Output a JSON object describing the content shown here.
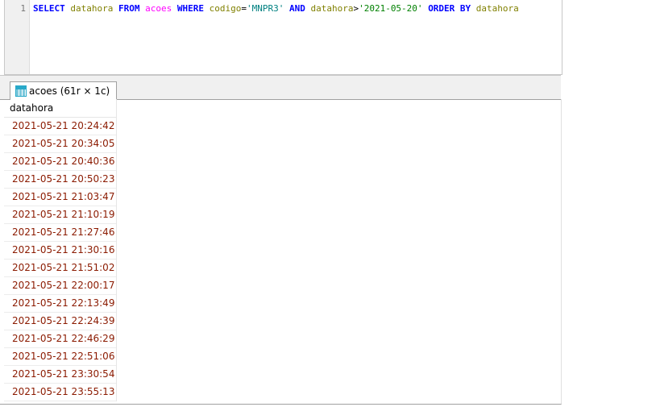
{
  "editor": {
    "line_number": "1",
    "tokens": [
      {
        "t": "SELECT",
        "c": "kw"
      },
      {
        "t": " ",
        "c": "op"
      },
      {
        "t": "datahora",
        "c": "id"
      },
      {
        "t": " ",
        "c": "op"
      },
      {
        "t": "FROM",
        "c": "kw"
      },
      {
        "t": " ",
        "c": "op"
      },
      {
        "t": "acoes",
        "c": "tb"
      },
      {
        "t": " ",
        "c": "op"
      },
      {
        "t": "WHERE",
        "c": "kw"
      },
      {
        "t": " ",
        "c": "op"
      },
      {
        "t": "codigo",
        "c": "id"
      },
      {
        "t": "=",
        "c": "op"
      },
      {
        "t": "'MNPR3'",
        "c": "st"
      },
      {
        "t": " ",
        "c": "op"
      },
      {
        "t": "AND",
        "c": "kw"
      },
      {
        "t": " ",
        "c": "op"
      },
      {
        "t": "datahora",
        "c": "id"
      },
      {
        "t": ">",
        "c": "op"
      },
      {
        "t": "'2021-05-20'",
        "c": "st2"
      },
      {
        "t": " ",
        "c": "op"
      },
      {
        "t": "ORDER BY",
        "c": "kw"
      },
      {
        "t": " ",
        "c": "op"
      },
      {
        "t": "datahora",
        "c": "id"
      }
    ]
  },
  "results": {
    "tab_label": "acoes (61r × 1c)",
    "column": "datahora",
    "rows": [
      "2021-05-21 20:24:42",
      "2021-05-21 20:34:05",
      "2021-05-21 20:40:36",
      "2021-05-21 20:50:23",
      "2021-05-21 21:03:47",
      "2021-05-21 21:10:19",
      "2021-05-21 21:27:46",
      "2021-05-21 21:30:16",
      "2021-05-21 21:51:02",
      "2021-05-21 22:00:17",
      "2021-05-21 22:13:49",
      "2021-05-21 22:24:39",
      "2021-05-21 22:46:29",
      "2021-05-21 22:51:06",
      "2021-05-21 23:30:54",
      "2021-05-21 23:55:13"
    ]
  }
}
